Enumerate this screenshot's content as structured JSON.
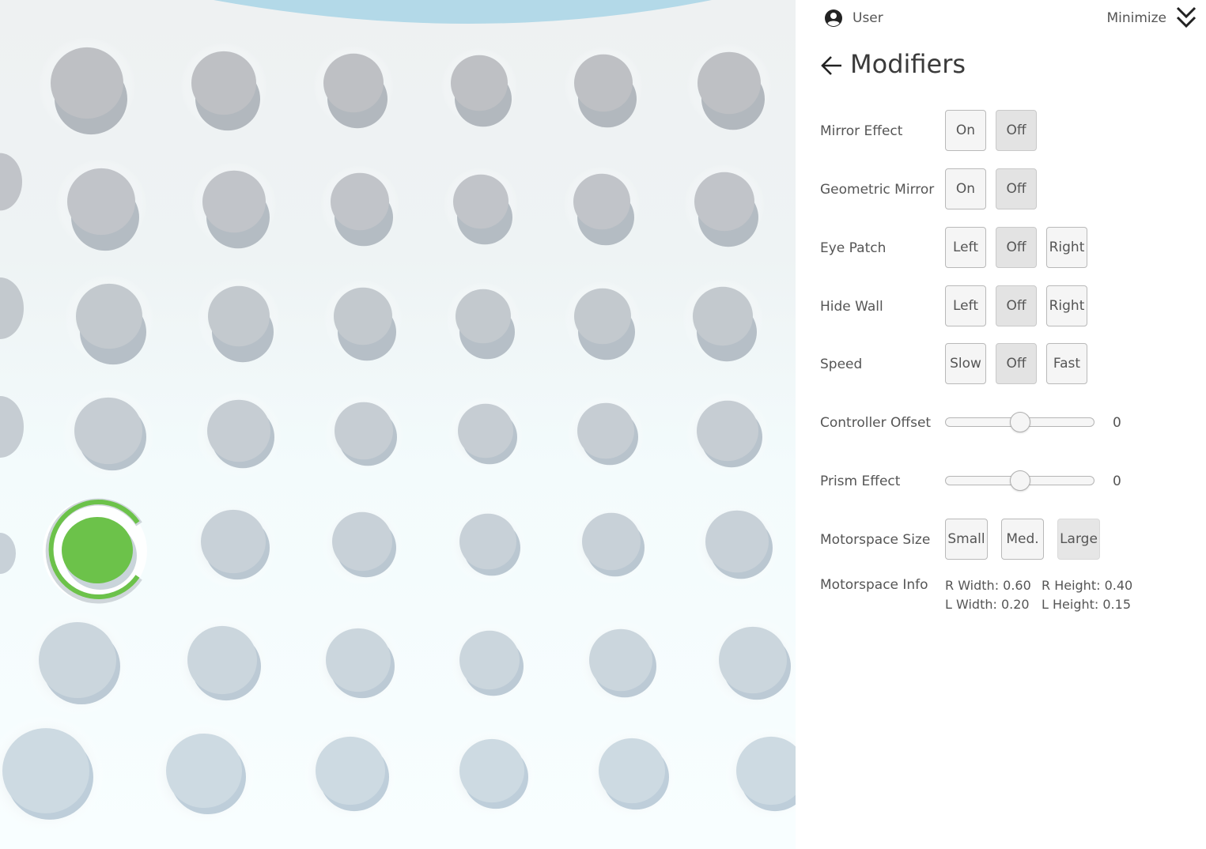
{
  "header": {
    "user_label": "User",
    "minimize_label": "Minimize"
  },
  "panel": {
    "title": "Modifiers"
  },
  "modifiers": {
    "mirror_effect": {
      "label": "Mirror Effect",
      "options": [
        "On",
        "Off"
      ],
      "selected": "Off"
    },
    "geometric_mirror": {
      "label": "Geometric Mirror",
      "options": [
        "On",
        "Off"
      ],
      "selected": "Off"
    },
    "eye_patch": {
      "label": "Eye Patch",
      "options": [
        "Left",
        "Off",
        "Right"
      ],
      "selected": "Off"
    },
    "hide_wall": {
      "label": "Hide Wall",
      "options": [
        "Left",
        "Off",
        "Right"
      ],
      "selected": "Off"
    },
    "speed": {
      "label": "Speed",
      "options": [
        "Slow",
        "Off",
        "Fast"
      ],
      "selected": "Off"
    },
    "controller_offset": {
      "label": "Controller Offset",
      "value": "0",
      "level": 0.5
    },
    "prism_effect": {
      "label": "Prism Effect",
      "value": "0",
      "level": 0.5
    },
    "motorspace_size": {
      "label": "Motorspace Size",
      "options": [
        "Small",
        "Med.",
        "Large"
      ],
      "selected": "Large"
    },
    "motorspace_info": {
      "label": "Motorspace Info",
      "r_width": "R Width: 0.60",
      "r_height": "R Height: 0.40",
      "l_width": "L Width: 0.20",
      "l_height": "L Height: 0.15"
    }
  },
  "scene": {
    "active_target_color": "#6cc24a",
    "target_color": "#c8d2d8",
    "ceiling_color": "#b3d9e8"
  }
}
